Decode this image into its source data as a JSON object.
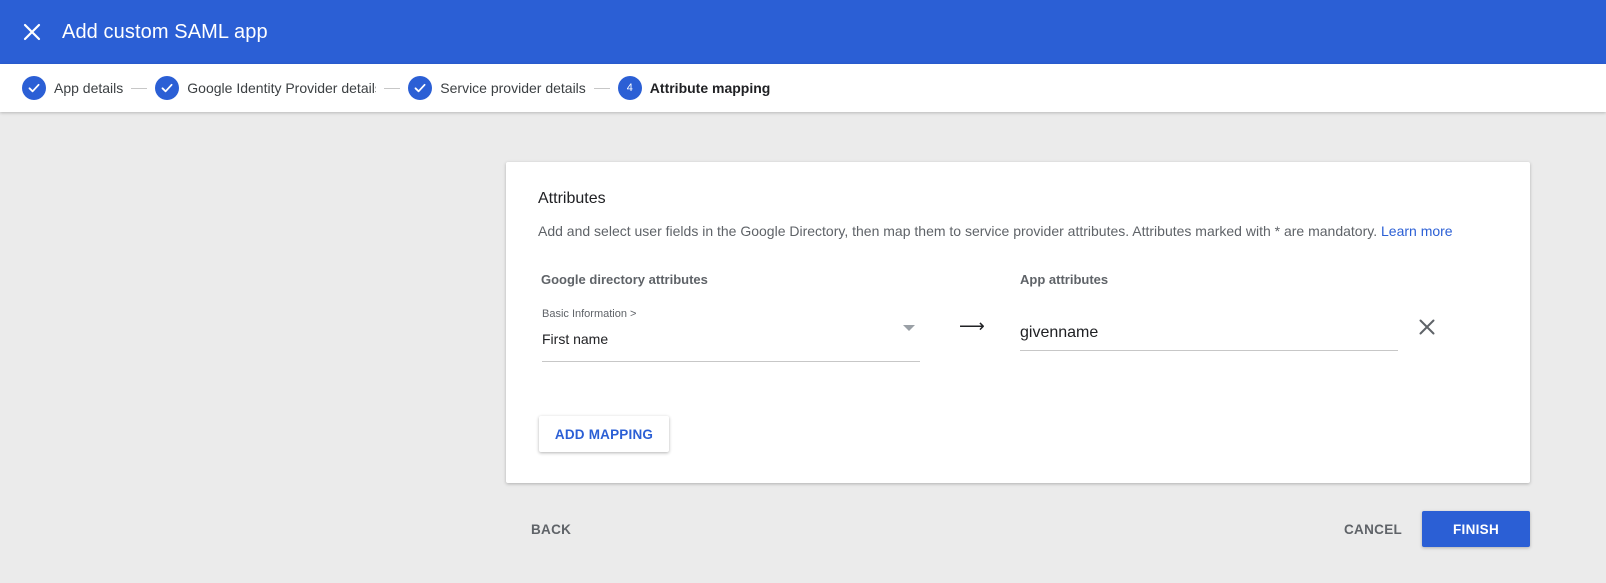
{
  "appbar": {
    "title": "Add custom SAML app",
    "close_icon": "close-icon",
    "color": "#2b5fd5"
  },
  "stepper": {
    "steps": [
      {
        "label": "App details",
        "state": "done",
        "icon": "check-icon"
      },
      {
        "label": "Google Identity Provider details",
        "state": "done",
        "icon": "check-icon"
      },
      {
        "label": "Service provider details",
        "state": "done",
        "icon": "check-icon"
      },
      {
        "label": "Attribute mapping",
        "state": "active",
        "number": "4"
      }
    ]
  },
  "card": {
    "title": "Attributes",
    "description": "Add and select user fields in the Google Directory, then map them to service provider attributes. Attributes marked with * are mandatory.",
    "learn_more": "Learn more",
    "left_header": "Google directory attributes",
    "right_header": "App attributes",
    "mapping": {
      "directory_category": "Basic Information >",
      "directory_value": "First name",
      "arrow": "⟶",
      "app_attribute": "givenname"
    },
    "add_mapping_label": "ADD MAPPING"
  },
  "footer": {
    "back_label": "BACK",
    "cancel_label": "CANCEL",
    "finish_label": "FINISH"
  }
}
